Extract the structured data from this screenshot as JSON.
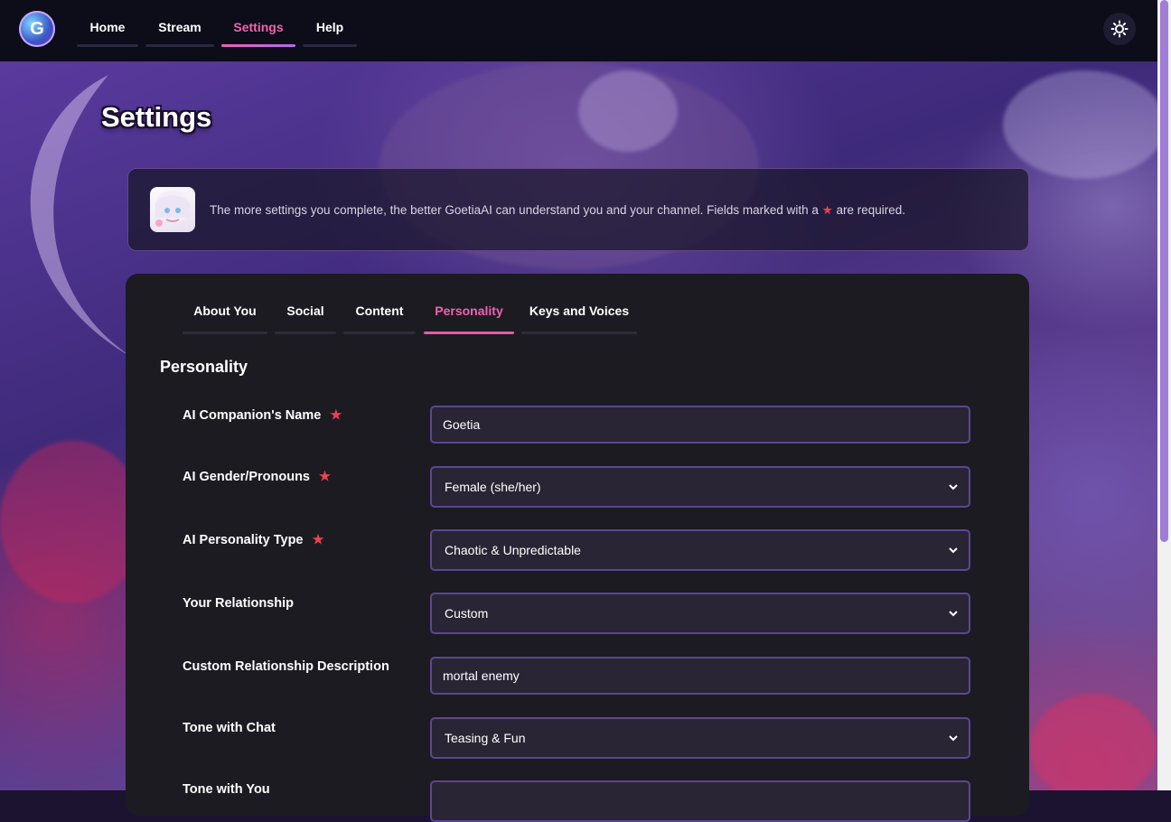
{
  "nav": {
    "logo_letter": "G",
    "items": [
      {
        "label": "Home"
      },
      {
        "label": "Stream"
      },
      {
        "label": "Settings"
      },
      {
        "label": "Help"
      }
    ],
    "active": "Settings",
    "theme_icon": "sun-icon"
  },
  "page": {
    "title": "Settings"
  },
  "notice": {
    "text_before": "The more settings you complete, the better GoetiaAI can understand you and your channel. Fields marked with a",
    "star": "★",
    "text_after": "are required."
  },
  "tabs": {
    "items": [
      {
        "label": "About You"
      },
      {
        "label": "Social"
      },
      {
        "label": "Content"
      },
      {
        "label": "Personality"
      },
      {
        "label": "Keys and Voices"
      }
    ],
    "active": "Personality"
  },
  "section": {
    "title": "Personality"
  },
  "fields": [
    {
      "label": "AI Companion's Name",
      "required": true,
      "type": "text",
      "value": "Goetia"
    },
    {
      "label": "AI Gender/Pronouns",
      "required": true,
      "type": "select",
      "value": "Female (she/her)"
    },
    {
      "label": "AI Personality Type",
      "required": true,
      "type": "select",
      "value": "Chaotic & Unpredictable"
    },
    {
      "label": "Your Relationship",
      "required": false,
      "type": "select",
      "value": "Custom"
    },
    {
      "label": "Custom Relationship Description",
      "required": false,
      "type": "text",
      "value": "mortal enemy"
    },
    {
      "label": "Tone with Chat",
      "required": false,
      "type": "select",
      "value": "Teasing & Fun"
    },
    {
      "label": "Tone with You",
      "required": false,
      "type": "select",
      "value": ""
    }
  ],
  "colors": {
    "accent": "#f063b0",
    "required_star": "#f04050",
    "field_border": "#5a4694",
    "card_bg": "#1c1b21",
    "topbar_bg": "#0d0c19"
  }
}
